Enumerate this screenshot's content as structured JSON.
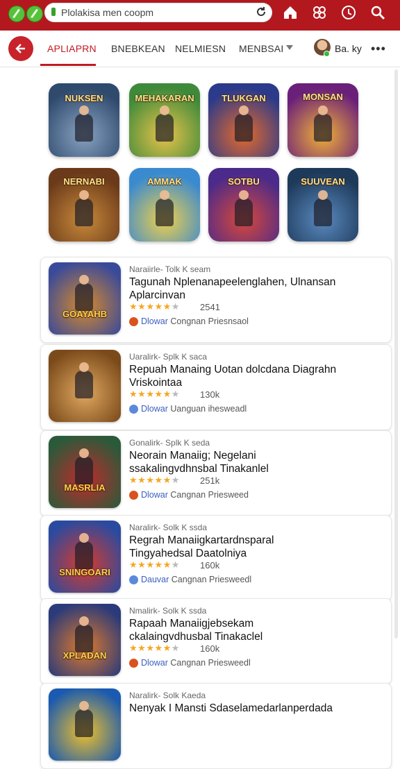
{
  "browser": {
    "url": "Plolakisa men coopm",
    "icons": [
      "green-circle-icon",
      "green-circle-icon",
      "reload-icon",
      "home-icon",
      "extensions-icon",
      "clock-icon",
      "search-icon"
    ]
  },
  "tabs": [
    {
      "label": "APLIAPRN",
      "active": true
    },
    {
      "label": "BNEBKEAN",
      "active": false
    },
    {
      "label": "NELMIESN",
      "active": false
    },
    {
      "label": "MENBSAI",
      "active": false
    }
  ],
  "user": {
    "name": "Ba. ky"
  },
  "grid": [
    {
      "title": "NUKSEN",
      "colors": [
        "#2f4a6d",
        "#8aa3c2"
      ]
    },
    {
      "title": "MEHAKARAN",
      "colors": [
        "#3f8a3a",
        "#e9c34a"
      ]
    },
    {
      "title": "TLUKGAN",
      "colors": [
        "#2b3a8a",
        "#e86a2a"
      ]
    },
    {
      "title": "MONSAN",
      "colors": [
        "#6a1f7a",
        "#f2b236"
      ]
    },
    {
      "title": "NERNABI",
      "colors": [
        "#6b3a1a",
        "#c88a3a"
      ]
    },
    {
      "title": "AMMAK",
      "colors": [
        "#3a8ad0",
        "#f0d04a"
      ]
    },
    {
      "title": "SOTBU",
      "colors": [
        "#4a2a8a",
        "#d9483a"
      ]
    },
    {
      "title": "SUUVEAN",
      "colors": [
        "#1e3a5a",
        "#5a8ac0"
      ]
    }
  ],
  "list": [
    {
      "thumb": "GOAYAHB",
      "colors": [
        "#3a4a9a",
        "#d98a2a"
      ],
      "subtitle": "Naraiirle- Tolk K seam",
      "title": "Tagunah Nplenanapeelenglahen, Ulnansan Aplarcinvan",
      "stars": 4,
      "count": "2541",
      "publisher_brand": "Dlowar",
      "publisher_rest": "Congnan Priesnsaol",
      "pub_color": "#d9531e"
    },
    {
      "thumb": "",
      "colors": [
        "#7a4a1a",
        "#e0a860"
      ],
      "subtitle": "Uaralirk- Splk K saca",
      "title": "Repuah Manaing Uotan dolcdana Diagrahn Vriskointaa",
      "stars": 4,
      "count": "130k",
      "publisher_brand": "Dlowar",
      "publisher_rest": "Uanguan ihesweadl",
      "pub_color": "#5a8ad9"
    },
    {
      "thumb": "MASRLIA",
      "colors": [
        "#2a5a3a",
        "#c02a2a"
      ],
      "subtitle": "Gonalirk- Splk K seda",
      "title": "Neorain Manaiig; Negelani ssakalingvdhnsbal Tinakanlel",
      "stars": 4,
      "count": "251k",
      "publisher_brand": "Dlowar",
      "publisher_rest": "Cangnan Priesweed",
      "pub_color": "#d9531e"
    },
    {
      "thumb": "SNINGOARI",
      "colors": [
        "#2a4aa0",
        "#d93a2a"
      ],
      "subtitle": "Naralirk- Solk K ssda",
      "title": "Regrah Manaiigkartardnsparal Tingyahedsal Daatolniya",
      "stars": 4,
      "count": "160k",
      "publisher_brand": "Dauvar",
      "publisher_rest": "Cangnan Priesweedl",
      "pub_color": "#5a8ad9"
    },
    {
      "thumb": "XPLADAN",
      "colors": [
        "#2a3a7a",
        "#e07a2a"
      ],
      "subtitle": "Nmalirk- Solk K ssda",
      "title": "Rapaah Manaiigjebsekam ckalaingvdhusbal Tinakaclel",
      "stars": 4,
      "count": "160k",
      "publisher_brand": "Dlowar",
      "publisher_rest": "Cangnan Priesweedl",
      "pub_color": "#d9531e"
    },
    {
      "thumb": "",
      "colors": [
        "#1a5ab0",
        "#f0c02a"
      ],
      "subtitle": "Naralirk- Solk Kaeda",
      "title": "Nenyak I Mansti Sdaselamedarlanperdada",
      "stars": 4,
      "count": "",
      "publisher_brand": "",
      "publisher_rest": "",
      "pub_color": "#5a8ad9"
    }
  ]
}
